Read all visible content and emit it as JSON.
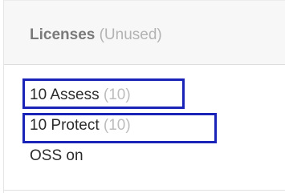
{
  "header": {
    "title": "Licenses",
    "subtitle": "(Unused)"
  },
  "licenses": [
    {
      "label": "10 Assess",
      "count": "(10)"
    },
    {
      "label": "10 Protect",
      "count": "(10)"
    },
    {
      "label": "OSS on",
      "count": ""
    }
  ],
  "colors": {
    "highlight": "#1a23b8",
    "header_bg": "#f7f7f7",
    "muted_text": "#b3b3b3"
  }
}
